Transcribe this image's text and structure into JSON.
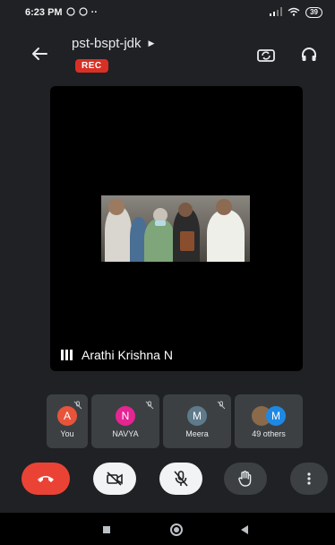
{
  "status_bar": {
    "time": "6:23 PM",
    "extra": "··",
    "battery": "39"
  },
  "meeting": {
    "title": "pst-bspt-jdk",
    "recording_label": "REC"
  },
  "main_tile": {
    "speaker_name": "Arathi Krishna N"
  },
  "participants": [
    {
      "initial": "A",
      "name": "You",
      "color": "#e8543a"
    },
    {
      "initial": "N",
      "name": "NAVYA",
      "color": "#e52592"
    },
    {
      "initial": "M",
      "name": "Meera",
      "color": "#5f7a8a"
    },
    {
      "initial": "M",
      "name": "49 others",
      "color": "#1e88e5"
    }
  ],
  "colors": {
    "background": "#202124",
    "tile": "#3c4043",
    "end_call": "#ea4335",
    "rec": "#d93025"
  }
}
